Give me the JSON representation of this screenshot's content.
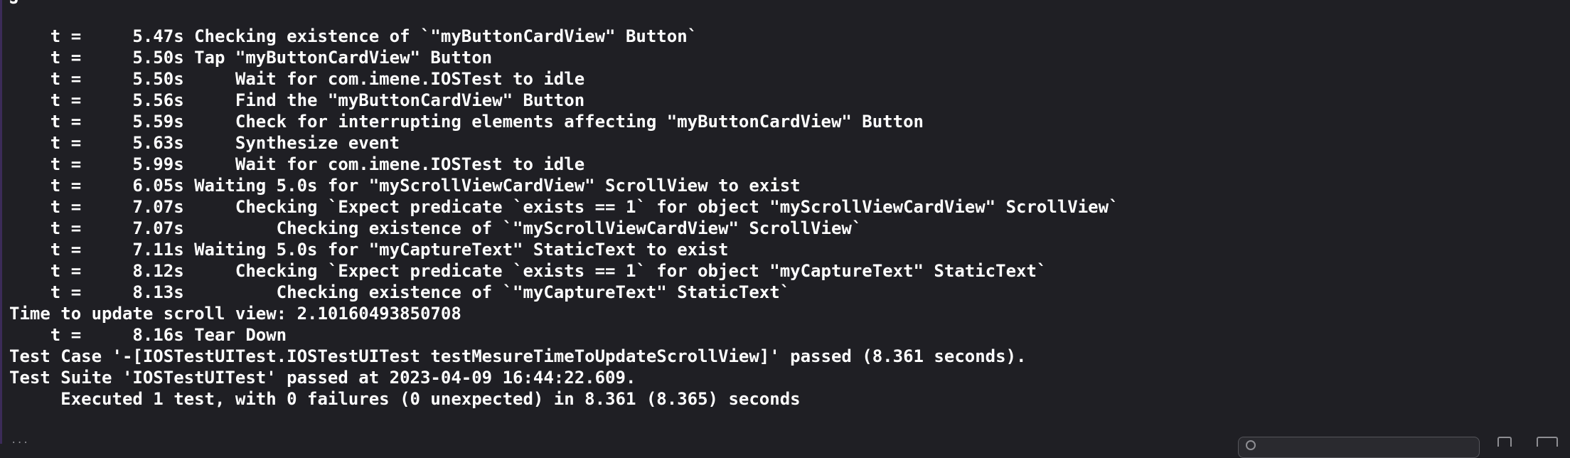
{
  "console": {
    "top_fragment": "J",
    "lines": [
      "    t =     5.47s Checking existence of `\"myButtonCardView\" Button`",
      "    t =     5.50s Tap \"myButtonCardView\" Button",
      "    t =     5.50s     Wait for com.imene.IOSTest to idle",
      "    t =     5.56s     Find the \"myButtonCardView\" Button",
      "    t =     5.59s     Check for interrupting elements affecting \"myButtonCardView\" Button",
      "    t =     5.63s     Synthesize event",
      "    t =     5.99s     Wait for com.imene.IOSTest to idle",
      "    t =     6.05s Waiting 5.0s for \"myScrollViewCardView\" ScrollView to exist",
      "    t =     7.07s     Checking `Expect predicate `exists == 1` for object \"myScrollViewCardView\" ScrollView`",
      "    t =     7.07s         Checking existence of `\"myScrollViewCardView\" ScrollView`",
      "    t =     7.11s Waiting 5.0s for \"myCaptureText\" StaticText to exist",
      "    t =     8.12s     Checking `Expect predicate `exists == 1` for object \"myCaptureText\" StaticText`",
      "    t =     8.13s         Checking existence of `\"myCaptureText\" StaticText`",
      "Time to update scroll view: 2.10160493850708",
      "    t =     8.16s Tear Down",
      "Test Case '-[IOSTestUITest.IOSTestUITest testMesureTimeToUpdateScrollView]' passed (8.361 seconds).",
      "Test Suite 'IOSTestUITest' passed at 2023-04-09 16:44:22.609.",
      "     Executed 1 test, with 0 failures (0 unexpected) in 8.361 (8.365) seconds"
    ]
  },
  "bottom_bar": {
    "left_fragment": "..."
  },
  "icons": {
    "filter": "filter-icon",
    "trash": "trash-icon",
    "split": "split-view-icon"
  },
  "colors": {
    "background": "#1f1f24",
    "text": "#ffffff",
    "accent_border": "#3b2b58"
  }
}
